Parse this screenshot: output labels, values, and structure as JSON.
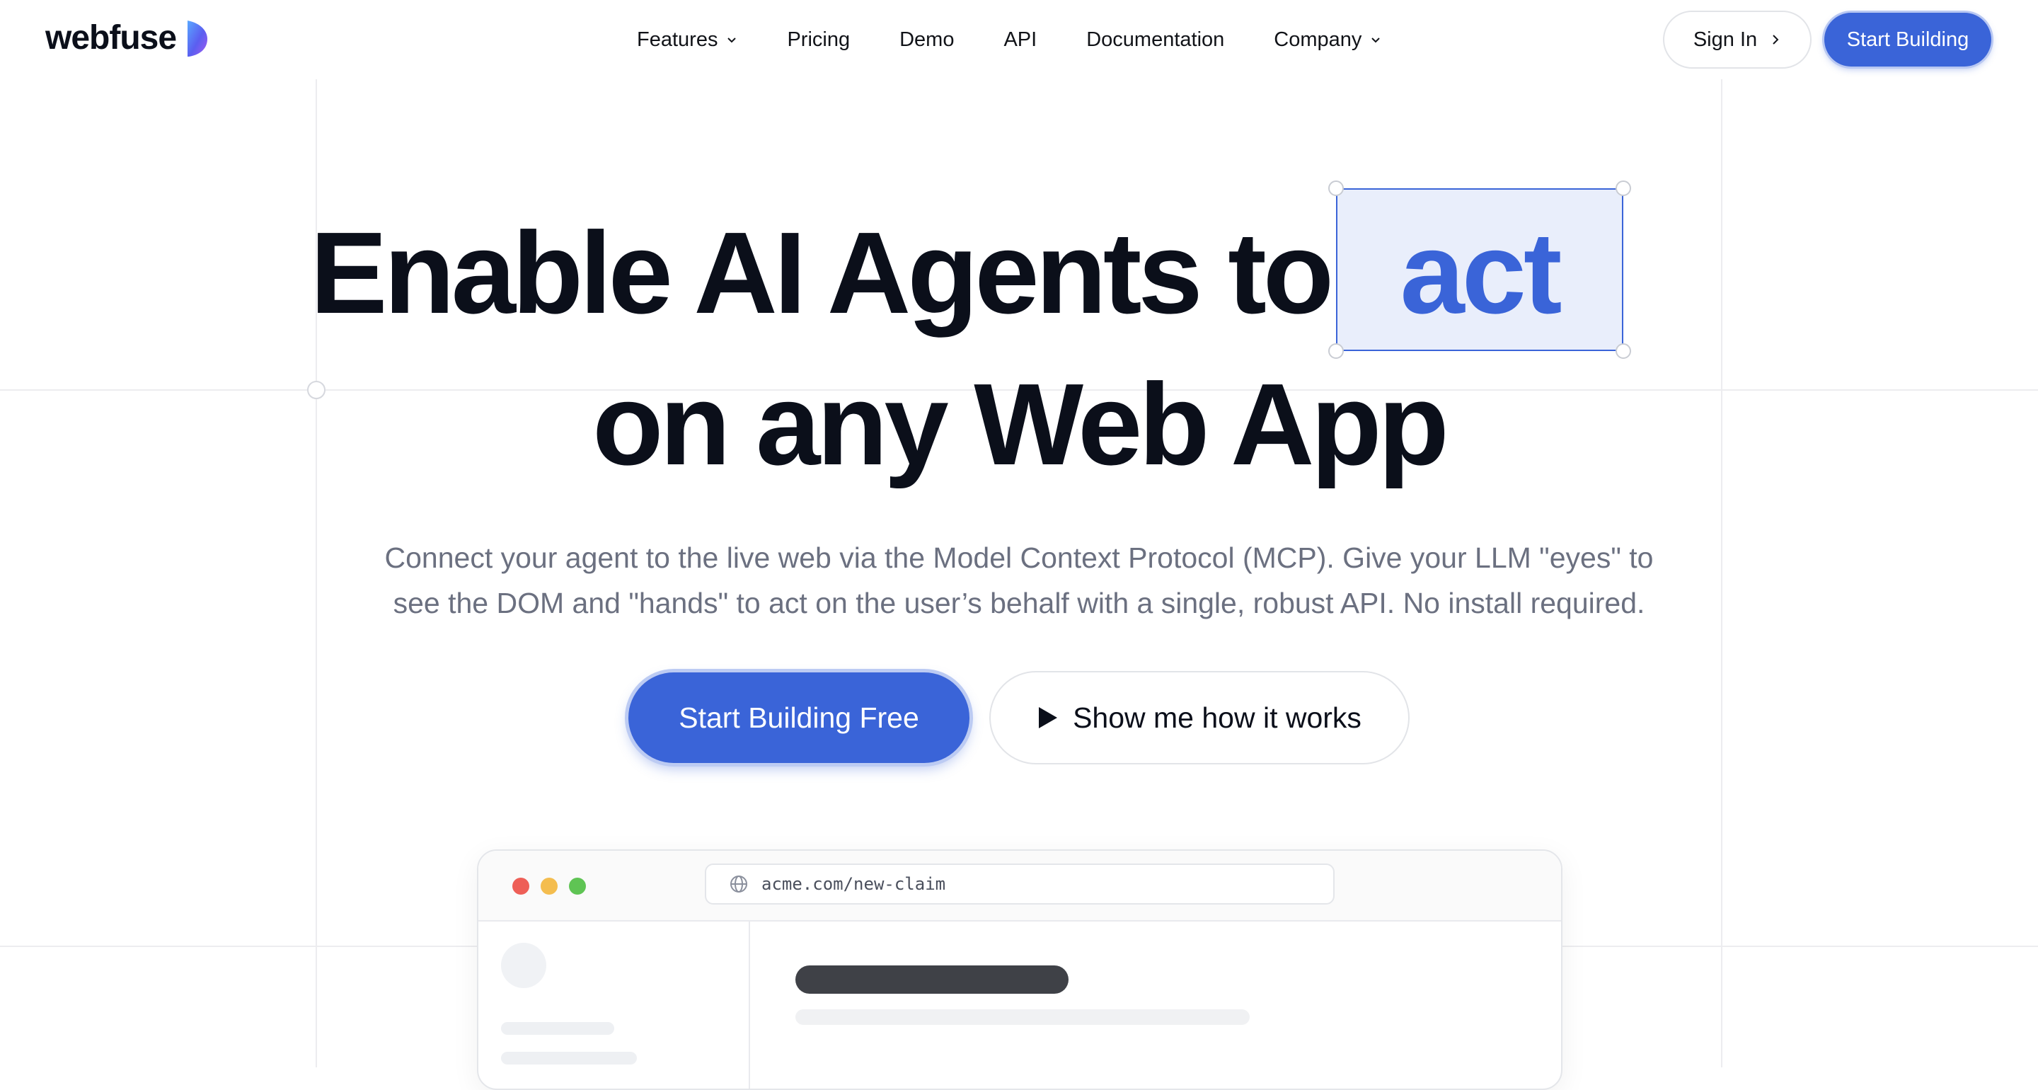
{
  "header": {
    "logo_text": "webfuse",
    "nav": [
      {
        "label": "Features",
        "dropdown": true
      },
      {
        "label": "Pricing",
        "dropdown": false
      },
      {
        "label": "Demo",
        "dropdown": false
      },
      {
        "label": "API",
        "dropdown": false
      },
      {
        "label": "Documentation",
        "dropdown": false
      },
      {
        "label": "Company",
        "dropdown": true
      }
    ],
    "sign_in_label": "Sign In",
    "cta_label": "Start Building"
  },
  "hero": {
    "title_line1": "Enable AI Agents to",
    "title_highlight": "act",
    "title_line2": "on any Web App",
    "subtitle_line1": "Connect your agent to the live web via the Model Context Protocol (MCP). Give your LLM \"eyes\" to",
    "subtitle_line2": "see the DOM and \"hands\" to act on the user’s behalf with a single, robust API. No install required.",
    "primary_cta": "Start Building Free",
    "secondary_cta": "Show me how it works"
  },
  "browser": {
    "url": "acme.com/new-claim"
  },
  "colors": {
    "accent": "#3a64d8",
    "highlight_bg": "#e9eefb",
    "text": "#0b0f1a",
    "muted": "#6b7080"
  },
  "icons": {
    "logo_mark": "webfuse-logo-mark",
    "nav_dropdown": "chevron-down-icon",
    "sign_in": "chevron-right-icon",
    "secondary_cta": "play-icon",
    "url_bar": "globe-icon"
  }
}
